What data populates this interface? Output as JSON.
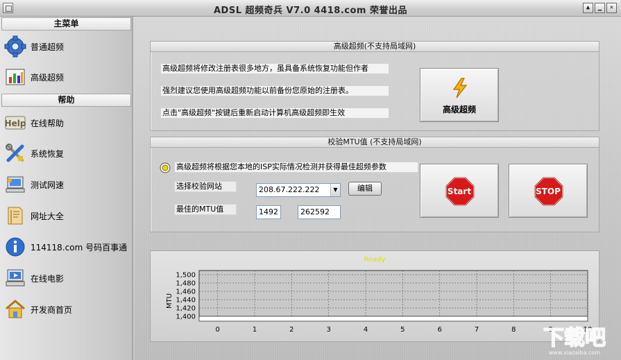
{
  "window": {
    "title": "ADSL 超频奇兵 V7.0 4418.com 荣誉出品",
    "help_glyph": "▲",
    "min_glyph": "▁",
    "close_glyph": "✕"
  },
  "sidebar": {
    "main_menu_header": "主菜单",
    "help_header": "帮助",
    "items": [
      {
        "label": "普通超频",
        "icon": "gear-icon"
      },
      {
        "label": "高级超频",
        "icon": "chart-icon"
      },
      {
        "label": "在线帮助",
        "icon": "help-icon"
      },
      {
        "label": "系统恢复",
        "icon": "tools-icon"
      },
      {
        "label": "测试网速",
        "icon": "network-computer-icon"
      },
      {
        "label": "网址大全",
        "icon": "book-icon"
      },
      {
        "label": "114118.com 号码百事通",
        "icon": "info-icon"
      },
      {
        "label": "在线电影",
        "icon": "movie-computer-icon"
      },
      {
        "label": "开发商首页",
        "icon": "home-icon"
      }
    ]
  },
  "advanced_panel": {
    "title": "高级超频(不支持局域网)",
    "lines": [
      "高级超频将修改注册表很多地方，虽具备系统恢复功能但作者",
      "强烈建议您使用高级超频功能以前备份您原始的注册表。",
      "点击\"高级超频\"按键后重新启动计算机高级超频即生效"
    ],
    "button_label": "高级超频"
  },
  "mtu_panel": {
    "title": "校验MTU值 (不支持局域网)",
    "radio_label": "高级超频将根据您本地的ISP实际情况检测并获得最佳超频参数",
    "site_label": "选择校验网站",
    "site_value": "208.67.222.222",
    "edit_button": "编辑",
    "best_mtu_label": "最佳的MTU值",
    "mtu_value": "1492",
    "second_value": "262592",
    "start_label": "Start",
    "stop_label": "STOP"
  },
  "chart_data": {
    "type": "line",
    "title": "Ready",
    "xlabel": "",
    "ylabel": "MTU",
    "xlim": [
      -0.5,
      10
    ],
    "ylim": [
      1400,
      1510
    ],
    "x_ticks": [
      "0",
      "1",
      "2",
      "3",
      "4",
      "5",
      "6",
      "7",
      "8",
      "9",
      "10"
    ],
    "y_ticks": [
      "1,400",
      "1,420",
      "1,440",
      "1,460",
      "1,480",
      "1,500"
    ],
    "series": [],
    "grid": true,
    "colors": {
      "title": "#e0e000",
      "plot_bg": "#c9c9c9",
      "grid": "#6e6e6e"
    }
  },
  "watermark": {
    "text": "下载吧",
    "url_text": "www.xiazaiba.com"
  }
}
